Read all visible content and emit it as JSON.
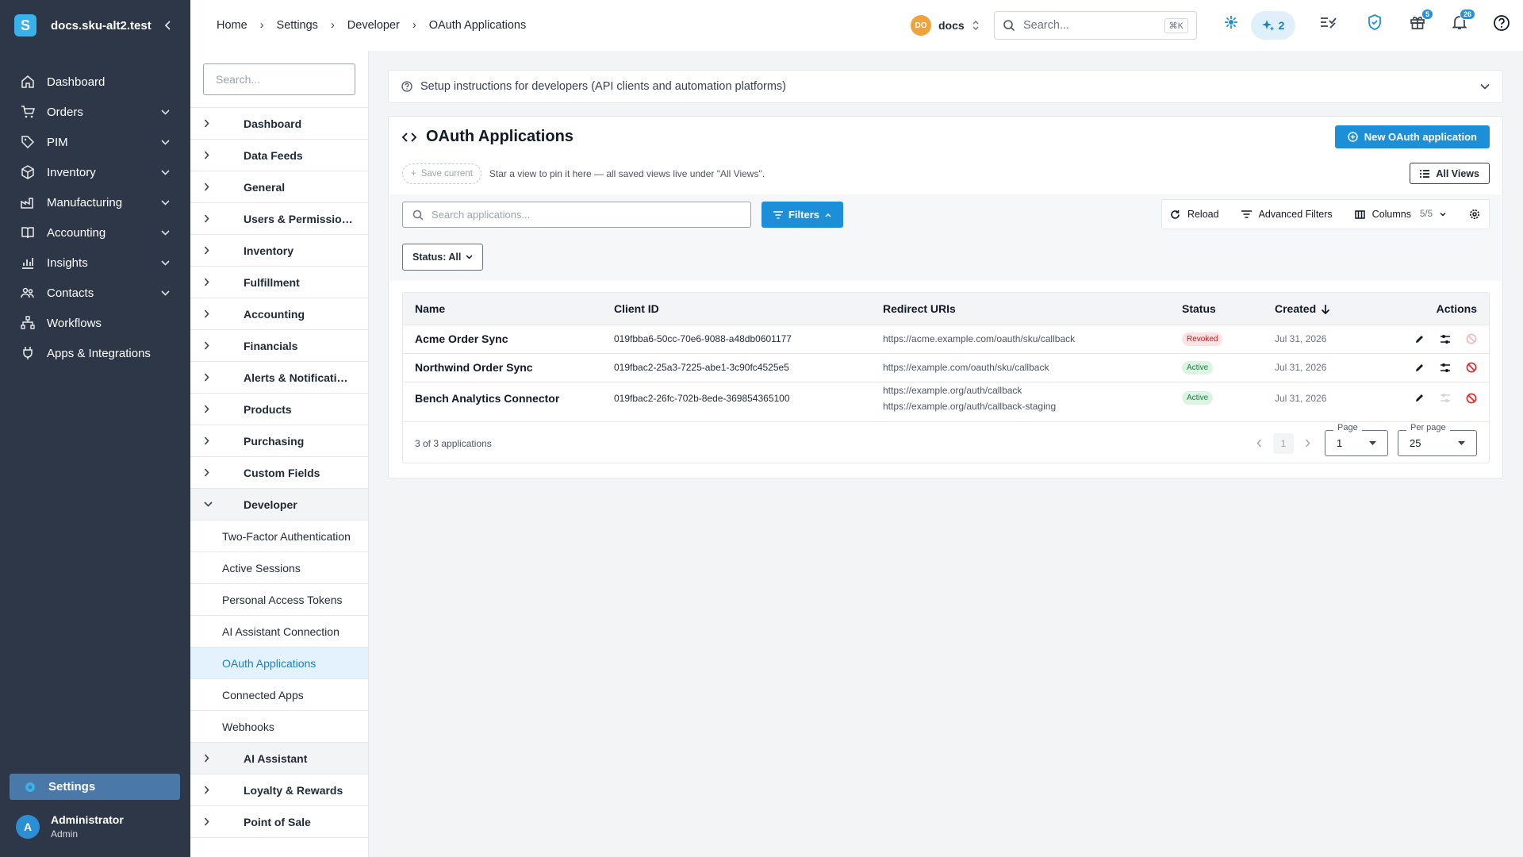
{
  "site": {
    "name": "docs.sku-alt2.test",
    "logo_letter": "S"
  },
  "nav": {
    "items": [
      {
        "label": "Dashboard",
        "icon": "home-icon",
        "expandable": false
      },
      {
        "label": "Orders",
        "icon": "cart-icon",
        "expandable": true
      },
      {
        "label": "PIM",
        "icon": "tag-icon",
        "expandable": true
      },
      {
        "label": "Inventory",
        "icon": "box-icon",
        "expandable": true
      },
      {
        "label": "Manufacturing",
        "icon": "factory-icon",
        "expandable": true
      },
      {
        "label": "Accounting",
        "icon": "book-icon",
        "expandable": true
      },
      {
        "label": "Insights",
        "icon": "chart-icon",
        "expandable": true
      },
      {
        "label": "Contacts",
        "icon": "people-icon",
        "expandable": true
      },
      {
        "label": "Workflows",
        "icon": "workflow-icon",
        "expandable": false
      },
      {
        "label": "Apps & Integrations",
        "icon": "plug-icon",
        "expandable": false
      }
    ],
    "settings_label": "Settings",
    "user": {
      "name": "Administrator",
      "role": "Admin",
      "initial": "A"
    }
  },
  "header": {
    "breadcrumb": [
      "Home",
      "Settings",
      "Developer",
      "OAuth Applications"
    ],
    "org": {
      "initials": "DO",
      "name": "docs"
    },
    "search": {
      "placeholder": "Search...",
      "shortcut": "⌘K"
    },
    "ai_count": "2",
    "gift_badge": "5",
    "bell_badge": "26"
  },
  "settings_menu": {
    "search_placeholder": "Search...",
    "sections": [
      "Dashboard",
      "Data Feeds",
      "General",
      "Users & Permissions",
      "Inventory",
      "Fulfillment",
      "Accounting",
      "Financials",
      "Alerts & Notifications",
      "Products",
      "Purchasing",
      "Custom Fields"
    ],
    "open_section": "Developer",
    "developer_items": [
      "Two-Factor Authentication",
      "Active Sessions",
      "Personal Access Tokens",
      "AI Assistant Connection",
      "OAuth Applications",
      "Connected Apps",
      "Webhooks"
    ],
    "active_item": "OAuth Applications",
    "after_sections": [
      "AI Assistant",
      "Loyalty & Rewards",
      "Point of Sale"
    ]
  },
  "setup_banner": "Setup instructions for developers (API clients and automation platforms)",
  "card": {
    "title": "OAuth Applications",
    "new_button": "New OAuth application",
    "save_current": "Save current",
    "views_hint": "Star a view to pin it here — all saved views live under \"All Views\".",
    "all_views": "All Views",
    "search_placeholder": "Search applications...",
    "filters": "Filters",
    "reload": "Reload",
    "advanced_filters": "Advanced Filters",
    "columns": "Columns",
    "columns_count": "5/5",
    "status_filter": "Status: All"
  },
  "table": {
    "headers": {
      "name": "Name",
      "client_id": "Client ID",
      "redirect": "Redirect URIs",
      "status": "Status",
      "created": "Created",
      "actions": "Actions"
    },
    "rows": [
      {
        "name": "Acme Order Sync",
        "client_id": "019fbba6-50cc-70e6-9088-a48db0601177",
        "uri1": "https://acme.example.com/oauth/sku/callback",
        "uri2": "",
        "status": "Revoked",
        "created": "Jul 31, 2026"
      },
      {
        "name": "Northwind Order Sync",
        "client_id": "019fbac2-25a3-7225-abe1-3c90fc4525e5",
        "uri1": "https://example.com/oauth/sku/callback",
        "uri2": "",
        "status": "Active",
        "created": "Jul 31, 2026"
      },
      {
        "name": "Bench Analytics Connector",
        "client_id": "019fbac2-26fc-702b-8ede-369854365100",
        "uri1": "https://example.org/auth/callback",
        "uri2": "https://example.org/auth/callback-staging",
        "status": "Active",
        "created": "Jul 31, 2026"
      }
    ],
    "summary": "3 of 3 applications",
    "current_page": "1",
    "page_label": "Page",
    "page_value": "1",
    "per_page_label": "Per page",
    "per_page_value": "25"
  },
  "colors": {
    "sidebar": "#2d3748",
    "accent": "#1d8fd8",
    "revoked": "#b91c1c",
    "active": "#15803d"
  }
}
